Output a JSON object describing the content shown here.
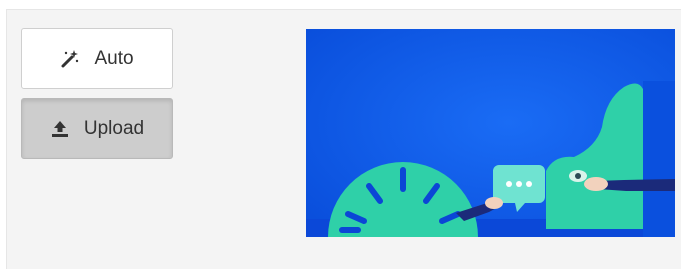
{
  "toolbar": {
    "auto_label": "Auto",
    "auto_icon": "magic-wand-icon",
    "upload_label": "Upload",
    "upload_icon": "upload-icon",
    "upload_active": true
  },
  "preview": {
    "image": "illustration-icon",
    "colors": {
      "background": "#0a56e6",
      "shape": "#2fd0a8",
      "floor": "#0b3fcf"
    }
  }
}
